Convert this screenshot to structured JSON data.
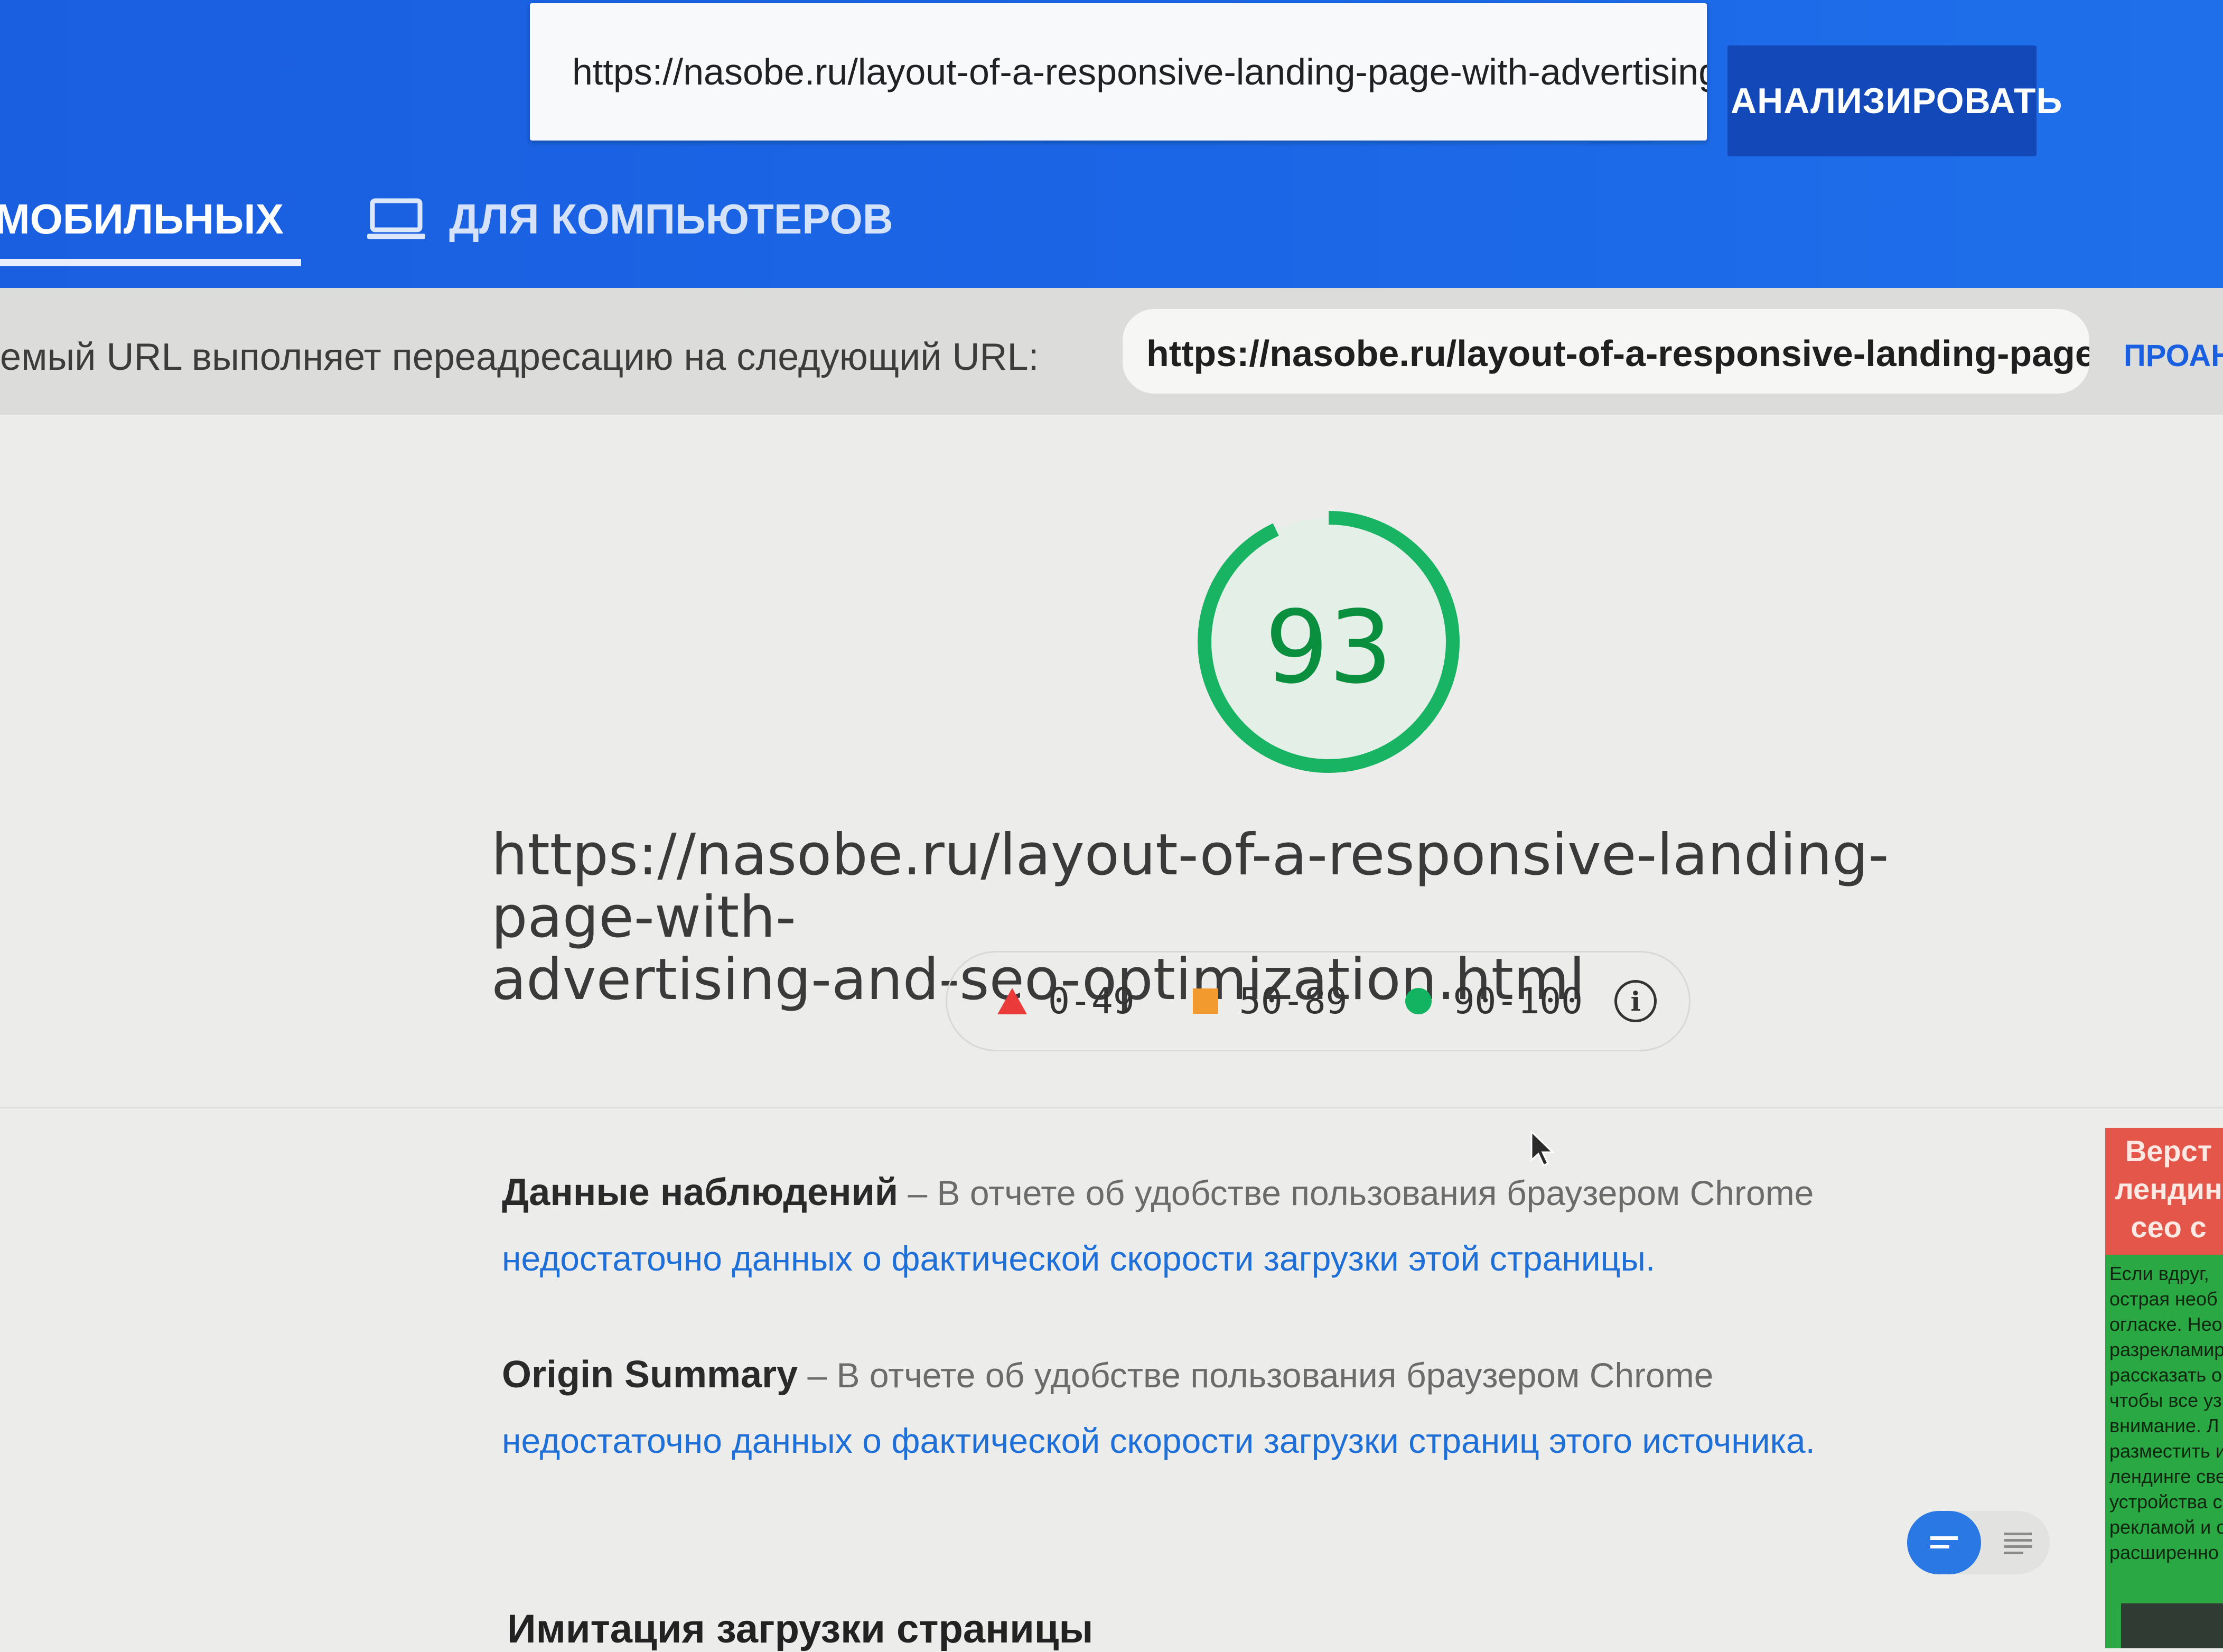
{
  "header": {
    "url_value": "https://nasobe.ru/layout-of-a-responsive-landing-page-with-advertising-and-s",
    "analyze_label": "АНАЛИЗИРОВАТЬ",
    "tabs": [
      {
        "label": "МОБИЛЬНЫХ",
        "icon": "phone-icon",
        "active": true
      },
      {
        "label": "ДЛЯ КОМПЬЮТЕРОВ",
        "icon": "laptop-icon",
        "active": false
      }
    ]
  },
  "redirect": {
    "text": "емый URL выполняет переадресацию на следующий URL:",
    "url": "https://nasobe.ru/layout-of-a-responsive-landing-page-wit...",
    "reanalyze_label": "ПРОАНА"
  },
  "score": {
    "value": "93",
    "fraction": 0.93,
    "color": "#18b363"
  },
  "analyzed_url": {
    "line1": "https://nasobe.ru/layout-of-a-responsive-landing-page-with-",
    "line2": "advertising-and-seo-optimization.html"
  },
  "legend": {
    "items": [
      {
        "label": "0-49",
        "shape": "triangle",
        "color": "#eb3a3a"
      },
      {
        "label": "50-89",
        "shape": "square",
        "color": "#f39a2e"
      },
      {
        "label": "90-100",
        "shape": "circle",
        "color": "#13b461"
      }
    ],
    "info_icon": "info-icon"
  },
  "field_data": {
    "title": "Данные наблюдений",
    "dash": "– В отчете об удобстве пользования браузером Chrome ",
    "link": "недостаточно данных о фактической скорости загрузки этой страницы."
  },
  "origin_summary": {
    "title": "Origin Summary",
    "dash": "– В отчете об удобстве пользования браузером Chrome ",
    "link": "недостаточно данных о фактической скорости загрузки страниц этого источника."
  },
  "lab_data": {
    "title": "Имитация загрузки страницы"
  },
  "ad": {
    "title": "Верст лендин сео с",
    "body": "Если вдруг, острая необ огласке. Нео разрекламир рассказать о чтобы все уз внимание. Л разместить и лендинге све устройства с рекламой и о расширенно"
  },
  "colors": {
    "header_blue": "#1b66e6",
    "button_blue": "#1348b8",
    "link_blue": "#1e6fd8",
    "score_green": "#18b363"
  }
}
